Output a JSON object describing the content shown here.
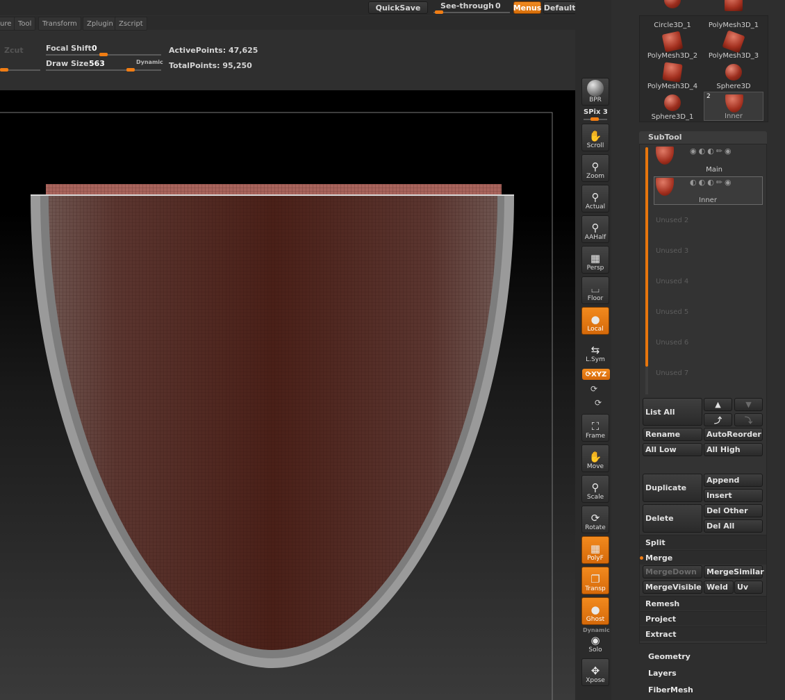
{
  "topbar": {
    "quicksave": "QuickSave",
    "see_through_label": "See-through",
    "see_through_value": "0",
    "menus": "Menus",
    "default_zscript": "DefaultZScript"
  },
  "menu": {
    "items": [
      "ure",
      "Tool",
      "Transform",
      "Zplugin",
      "Zscript"
    ]
  },
  "info": {
    "zcut": "Zcut",
    "focal_shift_label": "Focal Shift",
    "focal_shift_value": "0",
    "draw_size_label": "Draw Size",
    "draw_size_value": "563",
    "dynamic": "Dynamic",
    "active_points_label": "ActivePoints:",
    "active_points_value": "47,625",
    "total_points_label": "TotalPoints:",
    "total_points_value": "95,250"
  },
  "shelf": {
    "bpr": "BPR",
    "spix_label": "SPix",
    "spix_value": "3",
    "scroll": "Scroll",
    "zoom": "Zoom",
    "actual": "Actual",
    "aahalf": "AAHalf",
    "persp": "Persp",
    "floor": "Floor",
    "local": "Local",
    "lsym": "L.Sym",
    "xyz": "XYZ",
    "frame": "Frame",
    "move": "Move",
    "scale": "Scale",
    "rotate": "Rotate",
    "polyf": "PolyF",
    "transp": "Transp",
    "ghost": "Ghost",
    "dynamic": "Dynamic",
    "solo": "Solo",
    "xpose": "Xpose"
  },
  "tools": {
    "items": [
      "Circle3D_1",
      "PolyMesh3D_1",
      "PolyMesh3D_2",
      "PolyMesh3D_3",
      "PolyMesh3D_4",
      "Sphere3D",
      "Sphere3D_1",
      "Inner"
    ],
    "inner_badge": "2"
  },
  "subtool": {
    "title": "SubTool",
    "main": "Main",
    "inner": "Inner",
    "unused": [
      "Unused 2",
      "Unused 3",
      "Unused 4",
      "Unused 5",
      "Unused 6",
      "Unused 7"
    ],
    "list_all": "List All",
    "rename": "Rename",
    "autoreorder": "AutoReorder",
    "all_low": "All Low",
    "all_high": "All High",
    "duplicate": "Duplicate",
    "append": "Append",
    "insert": "Insert",
    "delete": "Delete",
    "del_other": "Del Other",
    "del_all": "Del All",
    "split": "Split",
    "merge": "Merge",
    "mergedown": "MergeDown",
    "mergesimilar": "MergeSimilar",
    "mergevisible": "MergeVisible",
    "weld": "Weld",
    "uv": "Uv",
    "remesh": "Remesh",
    "project": "Project",
    "extract": "Extract"
  },
  "sections": {
    "geometry": "Geometry",
    "layers": "Layers",
    "fibermesh": "FiberMesh"
  },
  "colors": {
    "accent": "#f07d14",
    "background": "#2f2f2f",
    "mesh": "#8a3a2c"
  }
}
